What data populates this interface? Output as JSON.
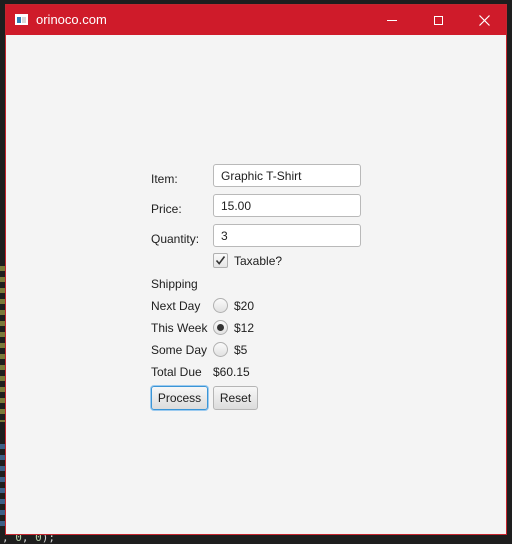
{
  "window": {
    "title": "orinoco.com",
    "titlebar_color": "#cf1b2a",
    "controls": [
      "minimize-icon",
      "maximize-icon",
      "close-icon"
    ]
  },
  "form": {
    "item": {
      "label": "Item:",
      "value": "Graphic T-Shirt"
    },
    "price": {
      "label": "Price:",
      "value": "15.00"
    },
    "quantity": {
      "label": "Quantity:",
      "value": "3"
    },
    "taxable": {
      "label": "Taxable?",
      "checked": true
    },
    "shipping": {
      "heading": "Shipping",
      "options": [
        {
          "label": "Next Day",
          "price": "$20",
          "selected": false
        },
        {
          "label": "This Week",
          "price": "$12",
          "selected": true
        },
        {
          "label": "Some Day",
          "price": "$5",
          "selected": false
        }
      ]
    },
    "total": {
      "label": "Total Due",
      "value": "$60.15"
    },
    "buttons": {
      "process": "Process",
      "reset": "Reset"
    }
  },
  "background": {
    "bottom_code_line": [
      ", ",
      "0",
      ", ",
      "0",
      ");"
    ]
  }
}
